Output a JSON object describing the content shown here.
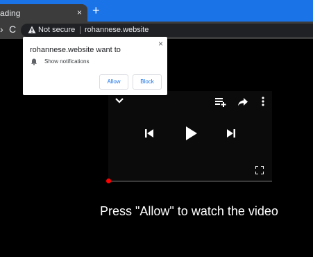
{
  "browser": {
    "tab_title": "ading",
    "tab_close": "×",
    "new_tab": "+",
    "nav_forward": "›",
    "reload": "C",
    "security_label": "Not secure",
    "url": "rohannese.website",
    "tab_bar_color": "#1b73e8"
  },
  "popup": {
    "title": "rohannese.website want to",
    "close": "×",
    "permission_icon": "bell-icon",
    "permission": "Show notifications",
    "allow_label": "Allow",
    "block_label": "Block"
  },
  "player": {
    "icons": [
      "chevron-down-icon",
      "add-to-queue-icon",
      "share-icon",
      "more-icon",
      "previous-icon",
      "play-icon",
      "next-icon",
      "fullscreen-icon"
    ],
    "progress_fraction": 0.0,
    "progress_color": "#ff0000"
  },
  "caption": "Press \"Allow\" to watch the video"
}
